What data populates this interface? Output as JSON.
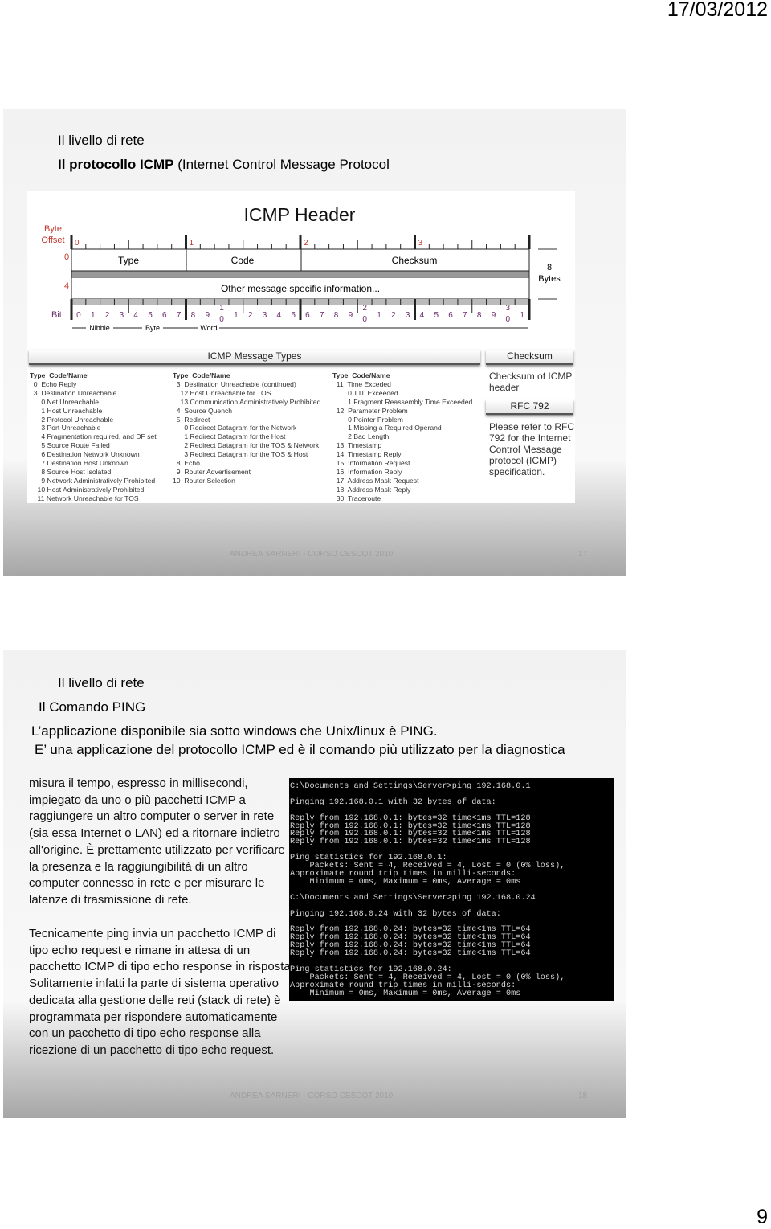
{
  "header_date": "17/03/2012",
  "page_number": "9",
  "footer": "ANDREA SARNERI - CORSO CESCOT 2010",
  "slide1": {
    "title1": "Il livello di rete",
    "title2_bold": "Il protocollo ICMP",
    "title2_rest": " (Internet Control Message Protocol",
    "slide_number": "17",
    "figure": {
      "title": "ICMP Header",
      "byte_offset_label": "Byte\nOffset",
      "byte_labels": [
        "0",
        "1",
        "2",
        "3"
      ],
      "row_offsets": [
        "0",
        "4"
      ],
      "fields": {
        "type": "Type",
        "code": "Code",
        "checksum": "Checksum",
        "other": "Other message specific information..."
      },
      "size_label": "8 Bytes",
      "bit_label": "Bit",
      "bit_numbers": [
        "0",
        "1",
        "2",
        "3",
        "4",
        "5",
        "6",
        "7",
        "8",
        "9",
        "1\n0",
        "1",
        "2",
        "3",
        "4",
        "5",
        "6",
        "7",
        "8",
        "9",
        "2\n0",
        "1",
        "2",
        "3",
        "4",
        "5",
        "6",
        "7",
        "8",
        "9",
        "3\n0",
        "1"
      ],
      "scale_labels": {
        "nibble": "Nibble",
        "byte": "Byte",
        "word": "Word"
      },
      "colors": {
        "offset_red": "#c0392b",
        "bit_purple": "#6b2d6b"
      },
      "message_types_header": "ICMP Message Types",
      "checksum_header": "Checksum",
      "columns": [
        {
          "header": "Type  Code/Name",
          "rows": [
            "  0  Echo Reply",
            "  3  Destination Unreachable",
            "      0 Net Unreachable",
            "      1 Host Unreachable",
            "      2 Protocol Unreachable",
            "      3 Port Unreachable",
            "      4 Fragmentation required, and DF set",
            "      5 Source Route Failed",
            "      6 Destination Network Unknown",
            "      7 Destination Host Unknown",
            "      8 Source Host Isolated",
            "      9 Network Administratively Prohibited",
            "    10 Host Administratively Prohibited",
            "    11 Network Unreachable for TOS"
          ]
        },
        {
          "header": "Type  Code/Name",
          "rows": [
            "  3  Destination Unreachable (continued)",
            "    12 Host Unreachable for TOS",
            "    13 Communication Administratively Prohibited",
            "  4  Source Quench",
            "  5  Redirect",
            "      0 Redirect Datagram for the Network",
            "      1 Redirect Datagram for the Host",
            "      2 Redirect Datagram for the TOS & Network",
            "      3 Redirect Datagram for the TOS & Host",
            "  8  Echo",
            "  9  Router Advertisement",
            "10  Router Selection"
          ]
        },
        {
          "header": "Type  Code/Name",
          "rows": [
            "  11  Time Exceded",
            "        0 TTL Exceeded",
            "        1 Fragment Reassembly Time Exceeded",
            "  12  Parameter Problem",
            "        0 Pointer Problem",
            "        1 Missing a Required Operand",
            "        2 Bad Length",
            "  13  Timestamp",
            "  14  Timestamp Reply",
            "  15  Information Request",
            "  16  Information Reply",
            "  17  Address Mask Request",
            "  18  Address Mask Reply",
            "  30  Traceroute"
          ]
        }
      ],
      "checksum_desc": "Checksum of ICMP header",
      "rfc_label": "RFC 792",
      "rfc_desc": "Please refer to RFC 792 for the Internet Control Message protocol (ICMP) specification."
    }
  },
  "slide2": {
    "title1": "Il livello di rete",
    "title2": "Il Comando PING",
    "line1": "L’applicazione disponibile sia sotto windows che Unix/linux è PING.",
    "line2": "E’ una applicazione del protocollo ICMP ed è il comando più utilizzato per la diagnostica",
    "para1": "misura il tempo, espresso in millisecondi, impiegato da uno o più pacchetti ICMP a raggiungere un altro computer o server in rete (sia essa Internet o LAN) ed a ritornare indietro all'origine. È prettamente utilizzato per verificare la presenza e la raggiungibilità di un altro computer connesso in rete e per misurare le latenze di trasmissione di rete.",
    "para2": "Tecnicamente ping invia un pacchetto ICMP di tipo echo request e rimane in attesa di un pacchetto ICMP di tipo echo response in risposta. Solitamente infatti la parte di sistema operativo dedicata alla gestione delle reti (stack di rete) è programmata per rispondere automaticamente con un pacchetto di tipo echo response alla ricezione di un pacchetto di tipo echo request.",
    "slide_number": "18",
    "terminal": "C:\\Documents and Settings\\Server>ping 192.168.0.1\n\nPinging 192.168.0.1 with 32 bytes of data:\n\nReply from 192.168.0.1: bytes=32 time<1ms TTL=128\nReply from 192.168.0.1: bytes=32 time<1ms TTL=128\nReply from 192.168.0.1: bytes=32 time<1ms TTL=128\nReply from 192.168.0.1: bytes=32 time<1ms TTL=128\n\nPing statistics for 192.168.0.1:\n    Packets: Sent = 4, Received = 4, Lost = 0 (0% loss),\nApproximate round trip times in milli-seconds:\n    Minimum = 0ms, Maximum = 0ms, Average = 0ms\n\nC:\\Documents and Settings\\Server>ping 192.168.0.24\n\nPinging 192.168.0.24 with 32 bytes of data:\n\nReply from 192.168.0.24: bytes=32 time<1ms TTL=64\nReply from 192.168.0.24: bytes=32 time<1ms TTL=64\nReply from 192.168.0.24: bytes=32 time<1ms TTL=64\nReply from 192.168.0.24: bytes=32 time<1ms TTL=64\n\nPing statistics for 192.168.0.24:\n    Packets: Sent = 4, Received = 4, Lost = 0 (0% loss),\nApproximate round trip times in milli-seconds:\n    Minimum = 0ms, Maximum = 0ms, Average = 0ms"
  }
}
